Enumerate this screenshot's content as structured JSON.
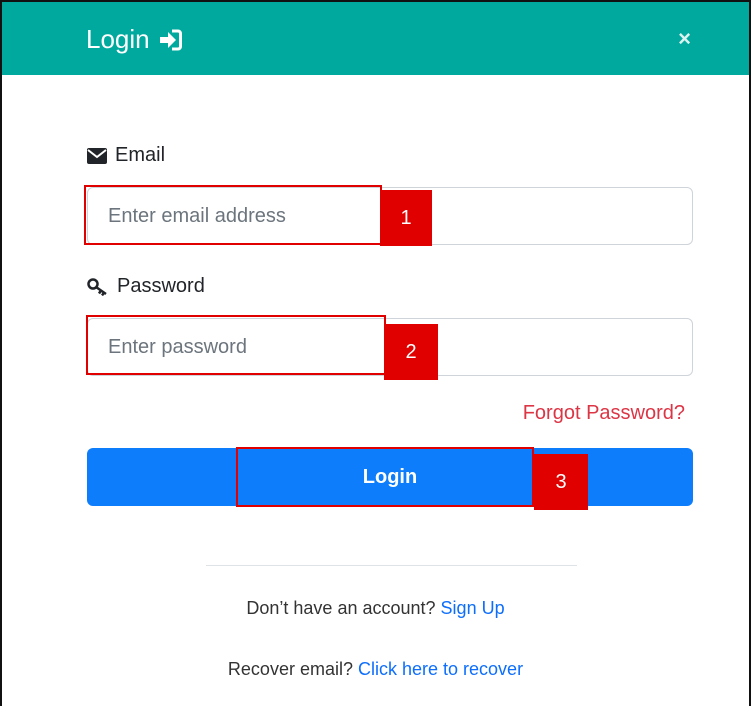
{
  "modal": {
    "title": "Login",
    "close_label": "×"
  },
  "form": {
    "email_label": "Email",
    "email_placeholder": "Enter email address",
    "password_label": "Password",
    "password_placeholder": "Enter password",
    "forgot_link": "Forgot Password?",
    "submit_label": "Login"
  },
  "annotations": [
    "1",
    "2",
    "3"
  ],
  "footer": {
    "signup_prompt": "Don’t have an account?",
    "signup_link": "Sign Up",
    "recover_prompt": "Recover email?",
    "recover_link": "Click here to recover"
  },
  "colors": {
    "header": "#00a99d",
    "button": "#0d7dfc",
    "link": "#0d6efd",
    "forgot": "#dc3545",
    "annotation": "#e00000"
  }
}
